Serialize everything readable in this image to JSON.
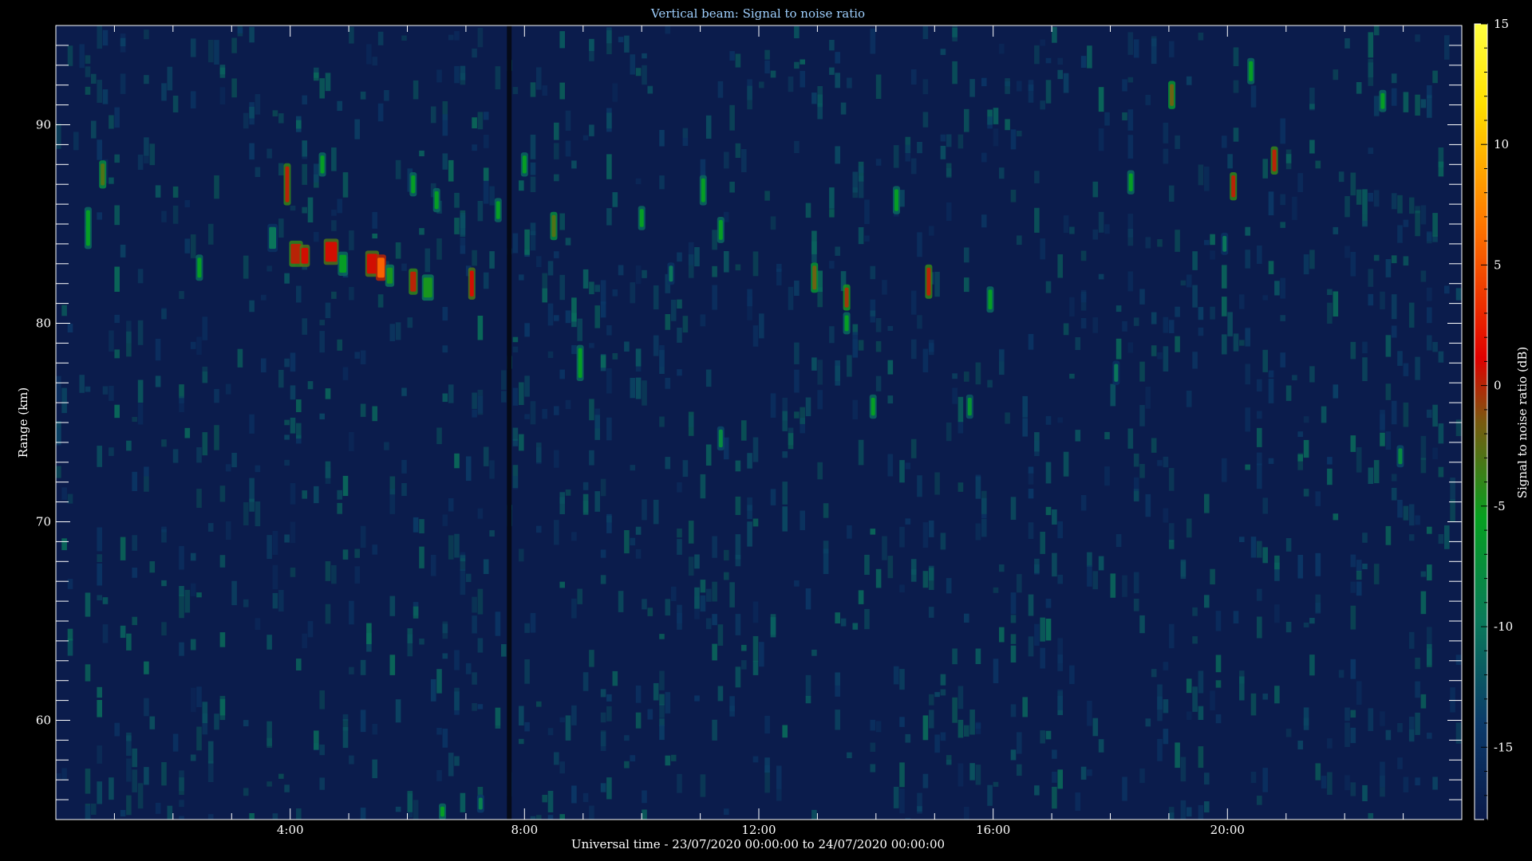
{
  "chart_data": {
    "type": "heatmap",
    "title": "Vertical beam: Signal to noise ratio",
    "xlabel": "Universal time - 23/07/2020 00:00:00 to 24/07/2020 00:00:00",
    "ylabel": "Range (km)",
    "colorbar_label": "Signal to noise ratio (dB)",
    "x_range_hours": [
      0,
      24
    ],
    "x_ticks": [
      {
        "value": 4,
        "label": "4:00"
      },
      {
        "value": 8,
        "label": "8:00"
      },
      {
        "value": 12,
        "label": "12:00"
      },
      {
        "value": 16,
        "label": "16:00"
      },
      {
        "value": 20,
        "label": "20:00"
      }
    ],
    "y_range": [
      55,
      95
    ],
    "y_ticks": [
      60,
      70,
      80,
      90
    ],
    "color_range": [
      -18,
      15
    ],
    "color_ticks": [
      -15,
      -10,
      -5,
      0,
      5,
      10,
      15
    ],
    "colormap": [
      "#0a1a4a",
      "#0b3a6a",
      "#0a7a5a",
      "#06a020",
      "#7a5a10",
      "#e00000",
      "#ff7800",
      "#ffe000",
      "#ffff40"
    ],
    "background_snr": -15,
    "gap_hours": [
      7.7,
      7.78
    ],
    "features": [
      {
        "t": 0.55,
        "r": 84.8,
        "snr": -6,
        "dt": 0.06,
        "dr": 1.8
      },
      {
        "t": 0.8,
        "r": 87.5,
        "snr": -3,
        "dt": 0.05,
        "dr": 1.1
      },
      {
        "t": 2.45,
        "r": 82.8,
        "snr": -6,
        "dt": 0.05,
        "dr": 1.0
      },
      {
        "t": 3.7,
        "r": 84.3,
        "snr": -10,
        "dt": 0.12,
        "dr": 1.1
      },
      {
        "t": 3.95,
        "r": 87.0,
        "snr": 1,
        "dt": 0.05,
        "dr": 1.8
      },
      {
        "t": 4.1,
        "r": 83.5,
        "snr": 1,
        "dt": 0.18,
        "dr": 1.0
      },
      {
        "t": 4.25,
        "r": 83.4,
        "snr": 2,
        "dt": 0.12,
        "dr": 0.8
      },
      {
        "t": 4.55,
        "r": 88.0,
        "snr": -6,
        "dt": 0.05,
        "dr": 0.9
      },
      {
        "t": 4.7,
        "r": 83.6,
        "snr": 2,
        "dt": 0.2,
        "dr": 1.0
      },
      {
        "t": 4.9,
        "r": 83.0,
        "snr": -6,
        "dt": 0.12,
        "dr": 0.9
      },
      {
        "t": 5.4,
        "r": 83.0,
        "snr": 2,
        "dt": 0.18,
        "dr": 1.0
      },
      {
        "t": 5.55,
        "r": 82.8,
        "snr": 6,
        "dt": 0.12,
        "dr": 1.0
      },
      {
        "t": 5.7,
        "r": 82.4,
        "snr": -5,
        "dt": 0.1,
        "dr": 0.8
      },
      {
        "t": 6.1,
        "r": 87.0,
        "snr": -6,
        "dt": 0.05,
        "dr": 0.9
      },
      {
        "t": 6.1,
        "r": 82.1,
        "snr": 1,
        "dt": 0.1,
        "dr": 1.0
      },
      {
        "t": 6.35,
        "r": 81.8,
        "snr": -5,
        "dt": 0.15,
        "dr": 1.0
      },
      {
        "t": 6.5,
        "r": 86.2,
        "snr": -6,
        "dt": 0.05,
        "dr": 0.9
      },
      {
        "t": 6.6,
        "r": 55.4,
        "snr": -6,
        "dt": 0.05,
        "dr": 0.5
      },
      {
        "t": 7.1,
        "r": 82.0,
        "snr": 2,
        "dt": 0.05,
        "dr": 1.3
      },
      {
        "t": 7.25,
        "r": 55.8,
        "snr": -9,
        "dt": 0.05,
        "dr": 0.6
      },
      {
        "t": 7.55,
        "r": 85.7,
        "snr": -6,
        "dt": 0.05,
        "dr": 0.9
      },
      {
        "t": 8.0,
        "r": 88.0,
        "snr": -6,
        "dt": 0.05,
        "dr": 0.9
      },
      {
        "t": 8.5,
        "r": 84.9,
        "snr": -3,
        "dt": 0.05,
        "dr": 1.1
      },
      {
        "t": 8.95,
        "r": 78.0,
        "snr": -6,
        "dt": 0.05,
        "dr": 1.5
      },
      {
        "t": 10.0,
        "r": 85.3,
        "snr": -6,
        "dt": 0.05,
        "dr": 0.9
      },
      {
        "t": 10.5,
        "r": 82.5,
        "snr": -10,
        "dt": 0.05,
        "dr": 0.8
      },
      {
        "t": 11.05,
        "r": 86.7,
        "snr": -6,
        "dt": 0.05,
        "dr": 1.2
      },
      {
        "t": 11.35,
        "r": 84.7,
        "snr": -6,
        "dt": 0.05,
        "dr": 1.0
      },
      {
        "t": 11.35,
        "r": 74.2,
        "snr": -8,
        "dt": 0.05,
        "dr": 0.9
      },
      {
        "t": 12.95,
        "r": 82.3,
        "snr": -2,
        "dt": 0.05,
        "dr": 1.2
      },
      {
        "t": 13.5,
        "r": 81.3,
        "snr": 0,
        "dt": 0.05,
        "dr": 1.0
      },
      {
        "t": 13.5,
        "r": 80.0,
        "snr": -6,
        "dt": 0.05,
        "dr": 0.8
      },
      {
        "t": 13.95,
        "r": 75.8,
        "snr": -6,
        "dt": 0.05,
        "dr": 0.9
      },
      {
        "t": 14.35,
        "r": 86.2,
        "snr": -6,
        "dt": 0.05,
        "dr": 1.1
      },
      {
        "t": 14.9,
        "r": 82.1,
        "snr": 1,
        "dt": 0.05,
        "dr": 1.4
      },
      {
        "t": 15.6,
        "r": 75.8,
        "snr": -7,
        "dt": 0.05,
        "dr": 0.9
      },
      {
        "t": 15.95,
        "r": 81.2,
        "snr": -6,
        "dt": 0.05,
        "dr": 1.0
      },
      {
        "t": 18.35,
        "r": 87.1,
        "snr": -6,
        "dt": 0.05,
        "dr": 0.9
      },
      {
        "t": 18.1,
        "r": 77.5,
        "snr": -10,
        "dt": 0.05,
        "dr": 0.9
      },
      {
        "t": 19.05,
        "r": 91.5,
        "snr": -2,
        "dt": 0.05,
        "dr": 1.1
      },
      {
        "t": 19.95,
        "r": 84.0,
        "snr": -10,
        "dt": 0.05,
        "dr": 0.8
      },
      {
        "t": 20.1,
        "r": 86.9,
        "snr": 1,
        "dt": 0.05,
        "dr": 1.1
      },
      {
        "t": 20.4,
        "r": 92.7,
        "snr": -6,
        "dt": 0.05,
        "dr": 1.0
      },
      {
        "t": 20.8,
        "r": 88.2,
        "snr": 1,
        "dt": 0.05,
        "dr": 1.1
      },
      {
        "t": 22.65,
        "r": 91.2,
        "snr": -6,
        "dt": 0.05,
        "dr": 0.8
      },
      {
        "t": 22.95,
        "r": 73.3,
        "snr": -8,
        "dt": 0.05,
        "dr": 0.8
      }
    ]
  }
}
